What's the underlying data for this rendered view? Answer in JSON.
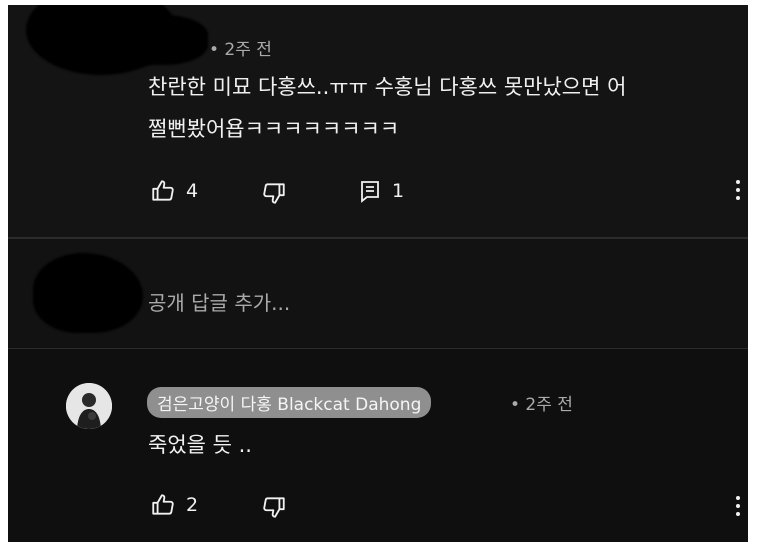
{
  "comment": {
    "time": "• 2주 전",
    "text_line1": "찬란한 미묘 다홍쓰..ㅠㅠ 수홍님 다홍쓰 못만났으면 어",
    "text_line2": "쩔뻔봤어욥ㅋㅋㅋㅋㅋㅋㅋㅋ",
    "likes": "4",
    "replies": "1"
  },
  "reply_box": {
    "placeholder": "공개 답글 추가..."
  },
  "reply": {
    "author": "검은고양이 다홍 Blackcat Dahong",
    "time": "• 2주 전",
    "text": "죽었을 듯 ..",
    "likes": "2"
  },
  "icons": {
    "like": "thumbs-up-icon",
    "dislike": "thumbs-down-icon",
    "reply": "comment-icon",
    "menu": "more-vertical-icon"
  },
  "colors": {
    "background": "#0f0f0f",
    "text": "#f1f1f1",
    "secondary": "#aaaaaa",
    "author_chip": "#8f8f8f"
  }
}
